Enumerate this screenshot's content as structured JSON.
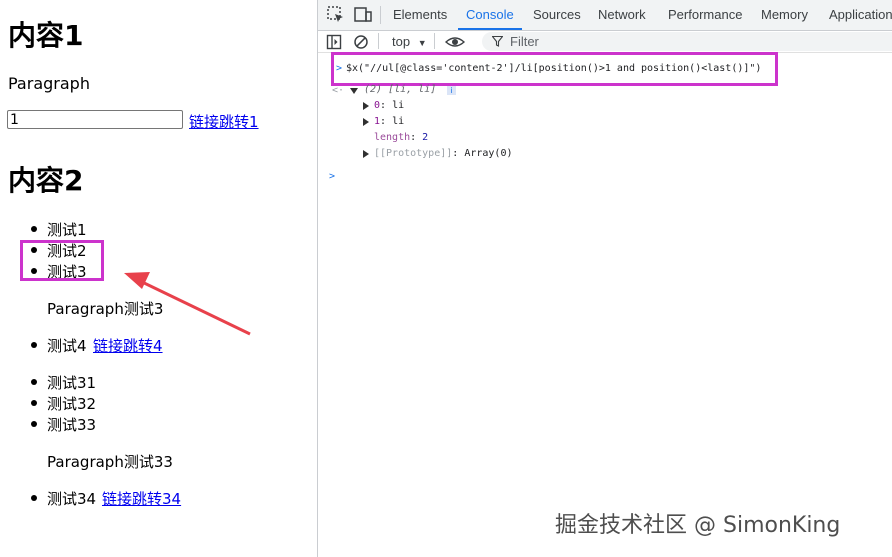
{
  "page": {
    "heading1": "内容1",
    "paragraph": "Paragraph",
    "input_value": "1",
    "link1": "链接跳转1",
    "heading2": "内容2",
    "list1": [
      "测试1",
      "测试2",
      "测试3"
    ],
    "para3": "Paragraph测试3",
    "item4": "测试4",
    "link4": "链接跳转4",
    "list2": [
      "测试31",
      "测试32",
      "测试33"
    ],
    "para33": "Paragraph测试33",
    "item34": "测试34",
    "link34": "链接跳转34"
  },
  "devtools": {
    "tabs": [
      "Elements",
      "Console",
      "Sources",
      "Network",
      "Performance",
      "Memory",
      "Application"
    ],
    "active_tab": "Console",
    "context": "top",
    "filter_placeholder": "Filter",
    "command": "$x(\"//ul[@class='content-2']/li[position()>1 and position()<last()]\")",
    "result_summary": "(2) [li, li]",
    "result_items": [
      {
        "index": "0",
        "value": "li"
      },
      {
        "index": "1",
        "value": "li"
      }
    ],
    "length_key": "length",
    "length_value": "2",
    "prototype_key": "[[Prototype]]",
    "prototype_value": "Array(0)"
  },
  "watermark": "掘金技术社区 @ SimonKing",
  "colors": {
    "highlight": "#cc33cc",
    "arrow": "#e8414b",
    "accent": "#1a73e8"
  }
}
